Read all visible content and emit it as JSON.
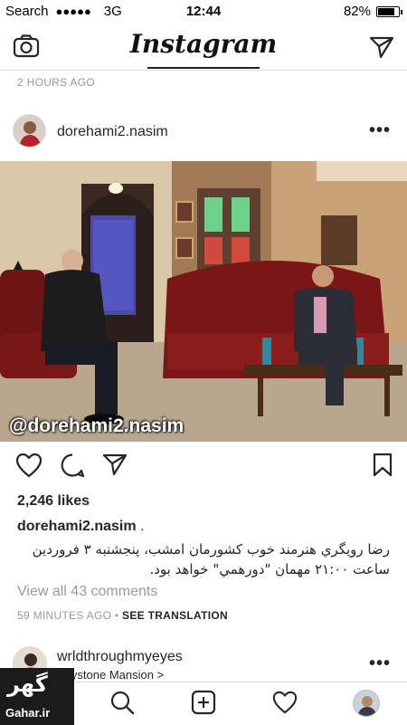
{
  "status_bar": {
    "carrier": "Search",
    "signal": "●●●●●",
    "network": "3G",
    "time": "12:44",
    "battery_text": "82%",
    "battery_level": 0.82
  },
  "nav": {
    "logo": "Instagram",
    "camera_icon": "camera-icon",
    "send_icon": "paper-plane-icon"
  },
  "previous_post": {
    "time": "2 HOURS AGO"
  },
  "post": {
    "username": "dorehami2.nasim",
    "more": "•••",
    "image_watermark": "@dorehami2.nasim",
    "likes": "2,246 likes",
    "caption_user": "dorehami2.nasim",
    "caption_suffix": ".",
    "caption_text": "رضا رويگري هنرمند خوب کشورمان امشب، پنجشنبه ۳ فروردين ساعت ۲۱:۰۰ مهمان \"دورهمي\" خواهد بود.",
    "view_comments": "View all 43 comments",
    "time": "59 MINUTES AGO",
    "separator": "•",
    "see_translation": "SEE TRANSLATION"
  },
  "next_post": {
    "username": "wrldthroughmyeyes",
    "location": "Keystone Mansion >",
    "more": "•••"
  },
  "tabs": [
    "home-icon",
    "search-icon",
    "add-post-icon",
    "heart-icon",
    "profile-avatar"
  ],
  "watermark": {
    "fa": "گهر",
    "en": "Gahar.ir"
  }
}
